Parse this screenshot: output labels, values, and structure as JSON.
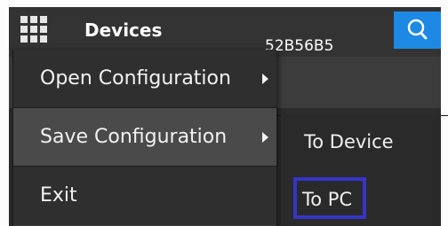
{
  "header": {
    "title": "Devices",
    "icons": {
      "menu": "grid-icon",
      "search": "search-icon"
    },
    "search_bg": "#1d89e4"
  },
  "content": {
    "device_id": "52B56B5"
  },
  "menu": {
    "items": [
      {
        "label": "Open Configuration",
        "has_submenu": true
      },
      {
        "label": "Save Configuration",
        "has_submenu": true,
        "active": true
      },
      {
        "label": "Exit",
        "has_submenu": false
      }
    ]
  },
  "submenu": {
    "items": [
      {
        "label": "To Device"
      },
      {
        "label": "To PC",
        "focused": true
      }
    ],
    "focus_color": "#3535c8"
  }
}
